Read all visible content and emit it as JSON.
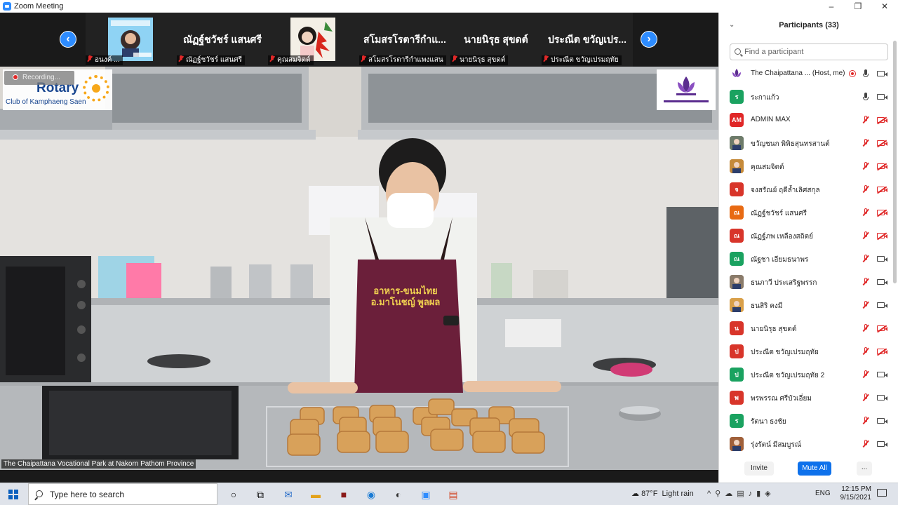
{
  "window": {
    "title": "Zoom Meeting",
    "controls": [
      "–",
      "❐",
      "✕"
    ]
  },
  "thumbnails": [
    {
      "label": "อนงค์ ...",
      "photo": "portrait-photo",
      "display": ""
    },
    {
      "label": "ณัฏฐ์ชวัชร์ แสนศรี",
      "photo": "",
      "display": "ณัฏฐ์ชวัชร์ แสนศรี"
    },
    {
      "label": "คุณสมจิตต์",
      "photo": "portrait-flower",
      "display": ""
    },
    {
      "label": "สโมสรโรตารีกำแพงแสน",
      "photo": "",
      "display": "สโมสรโรตารีกำแ..."
    },
    {
      "label": "นายนิรุธ สุขดต์",
      "photo": "",
      "display": "นายนิรุธ สุขดต์"
    },
    {
      "label": "ประณีต ขวัญเปรมฤทัย",
      "photo": "",
      "display": "ประณีต ขวัญเปร..."
    }
  ],
  "main_video": {
    "recording": "Recording...",
    "logo_left_title": "Rotary",
    "logo_left_sub": "Club of Kamphaeng Saen",
    "apron_line1": "อาหาร-ขนมไทย",
    "apron_line2": "อ.มาโนชญ์ พูลผล",
    "caption": "The Chaipattana Vocational Park at Nakorn Pathom Province"
  },
  "participants": {
    "title": "Participants (33)",
    "search_placeholder": "Find a participant",
    "rows": [
      {
        "name": "The Chaipattana ... (Host, me)",
        "initials": "",
        "color": "#ffffff",
        "avatar": "lotus",
        "recording": true,
        "mic": "on",
        "cam": "on"
      },
      {
        "name": "ระกาแก้ว",
        "initials": "ร",
        "color": "#1aa260",
        "mic": "on",
        "cam": "on"
      },
      {
        "name": "ADMIN MAX",
        "initials": "AM",
        "color": "#e02828",
        "mic": "off",
        "cam": "off"
      },
      {
        "name": "ขวัญชนก พิพิธสุนทรสานต์",
        "initials": "",
        "color": "#6d7b6a",
        "avatar": "photo",
        "mic": "off",
        "cam": "off"
      },
      {
        "name": "คุณสมจิตต์",
        "initials": "",
        "color": "#c58a3a",
        "avatar": "photo",
        "mic": "off",
        "cam": "off"
      },
      {
        "name": "จงสรัณย์ ฤดีล้ำเลิศสกุล",
        "initials": "จ",
        "color": "#d8352a",
        "mic": "off",
        "cam": "off"
      },
      {
        "name": "ณัฏฐ์ชวัชร์ แสนศรี",
        "initials": "ณ",
        "color": "#e86a13",
        "mic": "off",
        "cam": "off"
      },
      {
        "name": "ณัฏฐ์ภพ เหลืองสถิตย์",
        "initials": "ณ",
        "color": "#d8352a",
        "mic": "off",
        "cam": "off"
      },
      {
        "name": "ณัฐชา เอียมธนาพร",
        "initials": "ณ",
        "color": "#1aa260",
        "mic": "off",
        "cam": "on"
      },
      {
        "name": "ธนภาวี ประเสริฐพรรก",
        "initials": "",
        "color": "#8a7b6a",
        "avatar": "photo",
        "mic": "off",
        "cam": "on"
      },
      {
        "name": "ธนสิริ คงมี",
        "initials": "",
        "color": "#d9a04a",
        "avatar": "photo",
        "mic": "off",
        "cam": "on"
      },
      {
        "name": "นายนิรุธ สุขดต์",
        "initials": "น",
        "color": "#d8352a",
        "mic": "off",
        "cam": "off"
      },
      {
        "name": "ประณีต ขวัญเปรมฤทัย",
        "initials": "ป",
        "color": "#d8352a",
        "mic": "off",
        "cam": "off"
      },
      {
        "name": "ประณีต ขวัญเปรมฤทัย 2",
        "initials": "ป",
        "color": "#1aa260",
        "mic": "off",
        "cam": "on"
      },
      {
        "name": "พรพรรณ ศรีบัวเอี่ยม",
        "initials": "พ",
        "color": "#d8352a",
        "mic": "off",
        "cam": "on"
      },
      {
        "name": "รัตนา ธงชัย",
        "initials": "ร",
        "color": "#1aa260",
        "mic": "off",
        "cam": "on"
      },
      {
        "name": "รุ่งรัตน์ มีสมบูรณ์",
        "initials": "",
        "color": "#a0603a",
        "avatar": "photo",
        "mic": "off",
        "cam": "on"
      }
    ],
    "invite_label": "Invite",
    "mute_all_label": "Mute All",
    "more_label": "..."
  },
  "taskbar": {
    "search_placeholder": "Type here to search",
    "weather_temp": "87°F",
    "weather_text": "Light rain",
    "language": "ENG",
    "time": "12:15 PM",
    "date": "9/15/2021"
  },
  "colors": {
    "accent": "#2d8cff",
    "mute_red": "#e02828",
    "apron": "#6b1f3a"
  }
}
